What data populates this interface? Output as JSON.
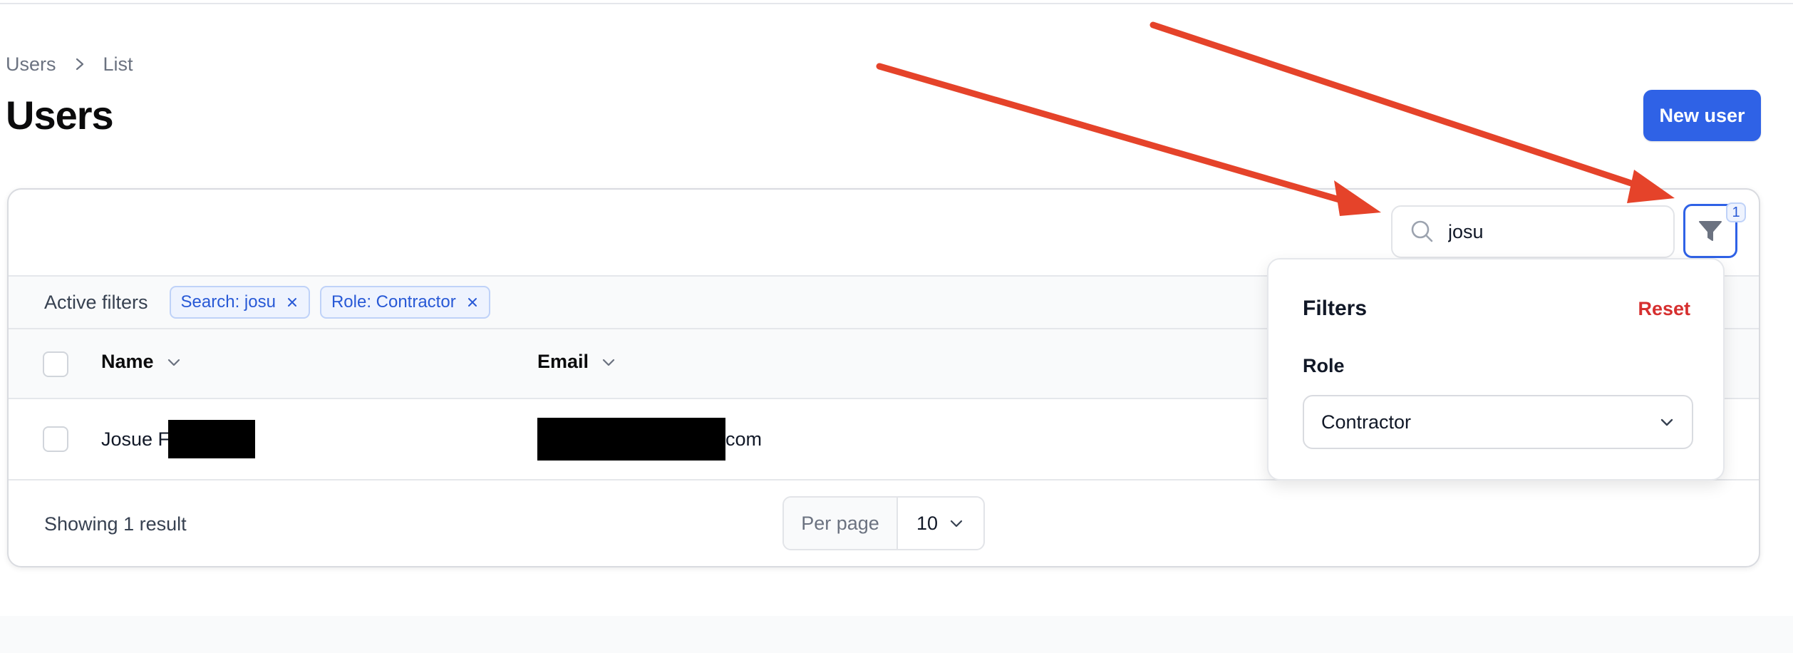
{
  "breadcrumb": {
    "items": [
      "Users",
      "List"
    ]
  },
  "page": {
    "title": "Users",
    "new_button": "New user"
  },
  "search": {
    "value": "josu"
  },
  "active_filters": {
    "label": "Active filters",
    "chips": [
      "Search: josu",
      "Role: Contractor"
    ]
  },
  "table": {
    "columns": [
      "Name",
      "Email"
    ],
    "rows": [
      {
        "name_visible": "Josue F",
        "email_visible": "com"
      }
    ]
  },
  "footer": {
    "result_text": "Showing 1 result",
    "per_page_label": "Per page",
    "per_page_value": "10"
  },
  "filter_button": {
    "badge": "1"
  },
  "filters_panel": {
    "title": "Filters",
    "reset": "Reset",
    "role_label": "Role",
    "role_value": "Contractor"
  },
  "colors": {
    "primary": "#2f62e6",
    "danger": "#d62f2f",
    "annotation_arrow": "#e5432a",
    "redaction": "#000000"
  },
  "icons": [
    "chevron-right-icon",
    "search-icon",
    "close-icon",
    "chevron-down-icon",
    "funnel-icon"
  ]
}
